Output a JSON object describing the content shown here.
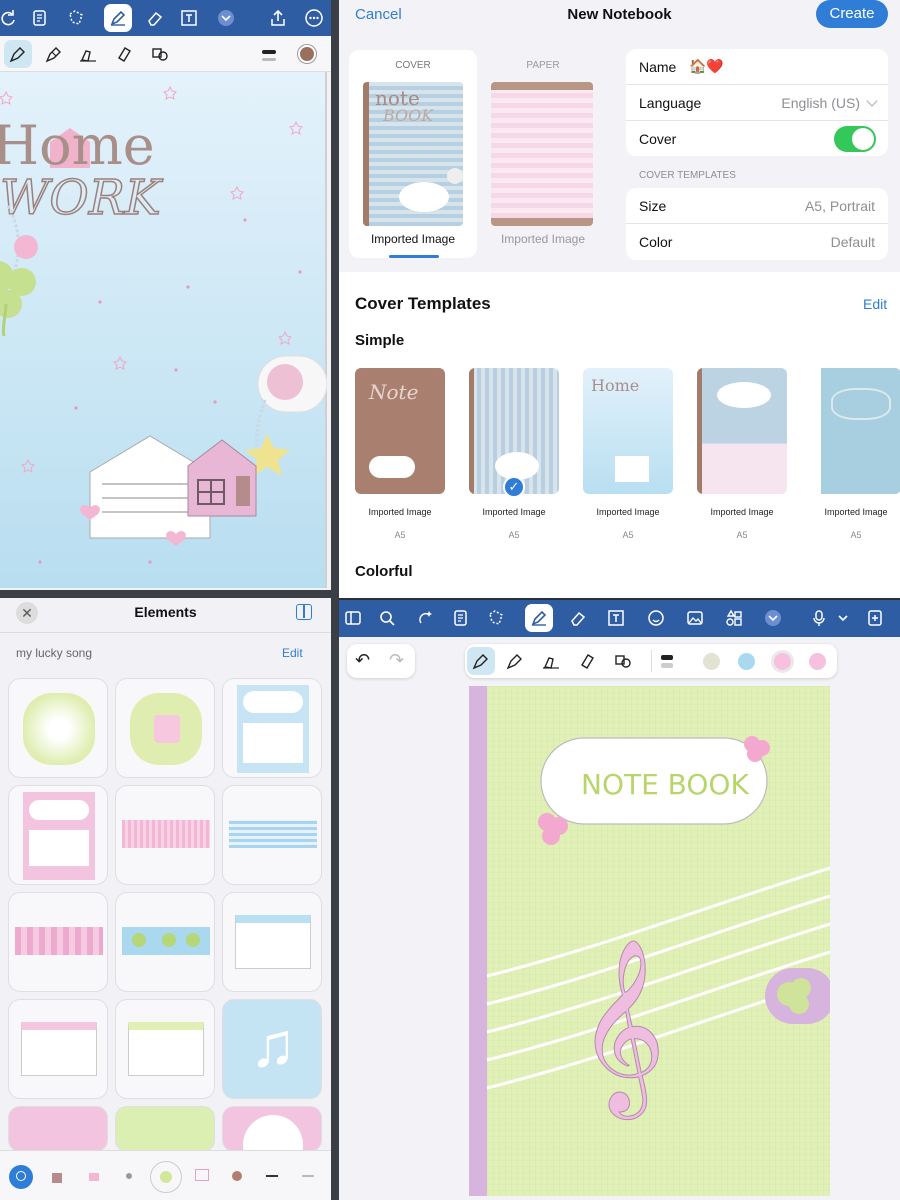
{
  "new_notebook": {
    "cancel": "Cancel",
    "title": "New Notebook",
    "create": "Create",
    "cover_tab": "COVER",
    "paper_tab": "PAPER",
    "cover_caption": "Imported Image",
    "paper_caption": "Imported Image",
    "name_label": "Name",
    "name_value": "🏠❤️",
    "language_label": "Language",
    "language_value": "English (US)",
    "cover_label": "Cover",
    "cover_toggle_on": true,
    "cover_templates_header": "COVER TEMPLATES",
    "size_label": "Size",
    "size_value": "A5, Portrait",
    "color_label": "Color",
    "color_value": "Default",
    "section_title": "Cover Templates",
    "edit": "Edit",
    "simple": "Simple",
    "colorful": "Colorful",
    "templates": [
      {
        "caption": "Imported Image",
        "size": "A5"
      },
      {
        "caption": "Imported Image",
        "size": "A5",
        "selected": true
      },
      {
        "caption": "Imported Image",
        "size": "A5"
      },
      {
        "caption": "Imported Image",
        "size": "A5"
      },
      {
        "caption": "Imported Image",
        "size": "A5"
      }
    ]
  },
  "cover_art": {
    "home_title": "Home",
    "work_title": "WORK",
    "note_small": "note",
    "book_small": "BOOK",
    "notebook_title": "NOTE BOOK"
  },
  "elements": {
    "title": "Elements",
    "album": "my lucky song",
    "edit": "Edit"
  },
  "colors": {
    "toolbar_blue": "#2f5da4",
    "accent_blue": "#2f7dd6",
    "toggle_green": "#34c759",
    "pink": "#f4b8d8",
    "lavender": "#d9b6e0",
    "mint": "#dff0b5",
    "swatch_cream": "#e3e3d3",
    "swatch_blue": "#a8d9ef",
    "swatch_pink": "#f7c0df"
  }
}
